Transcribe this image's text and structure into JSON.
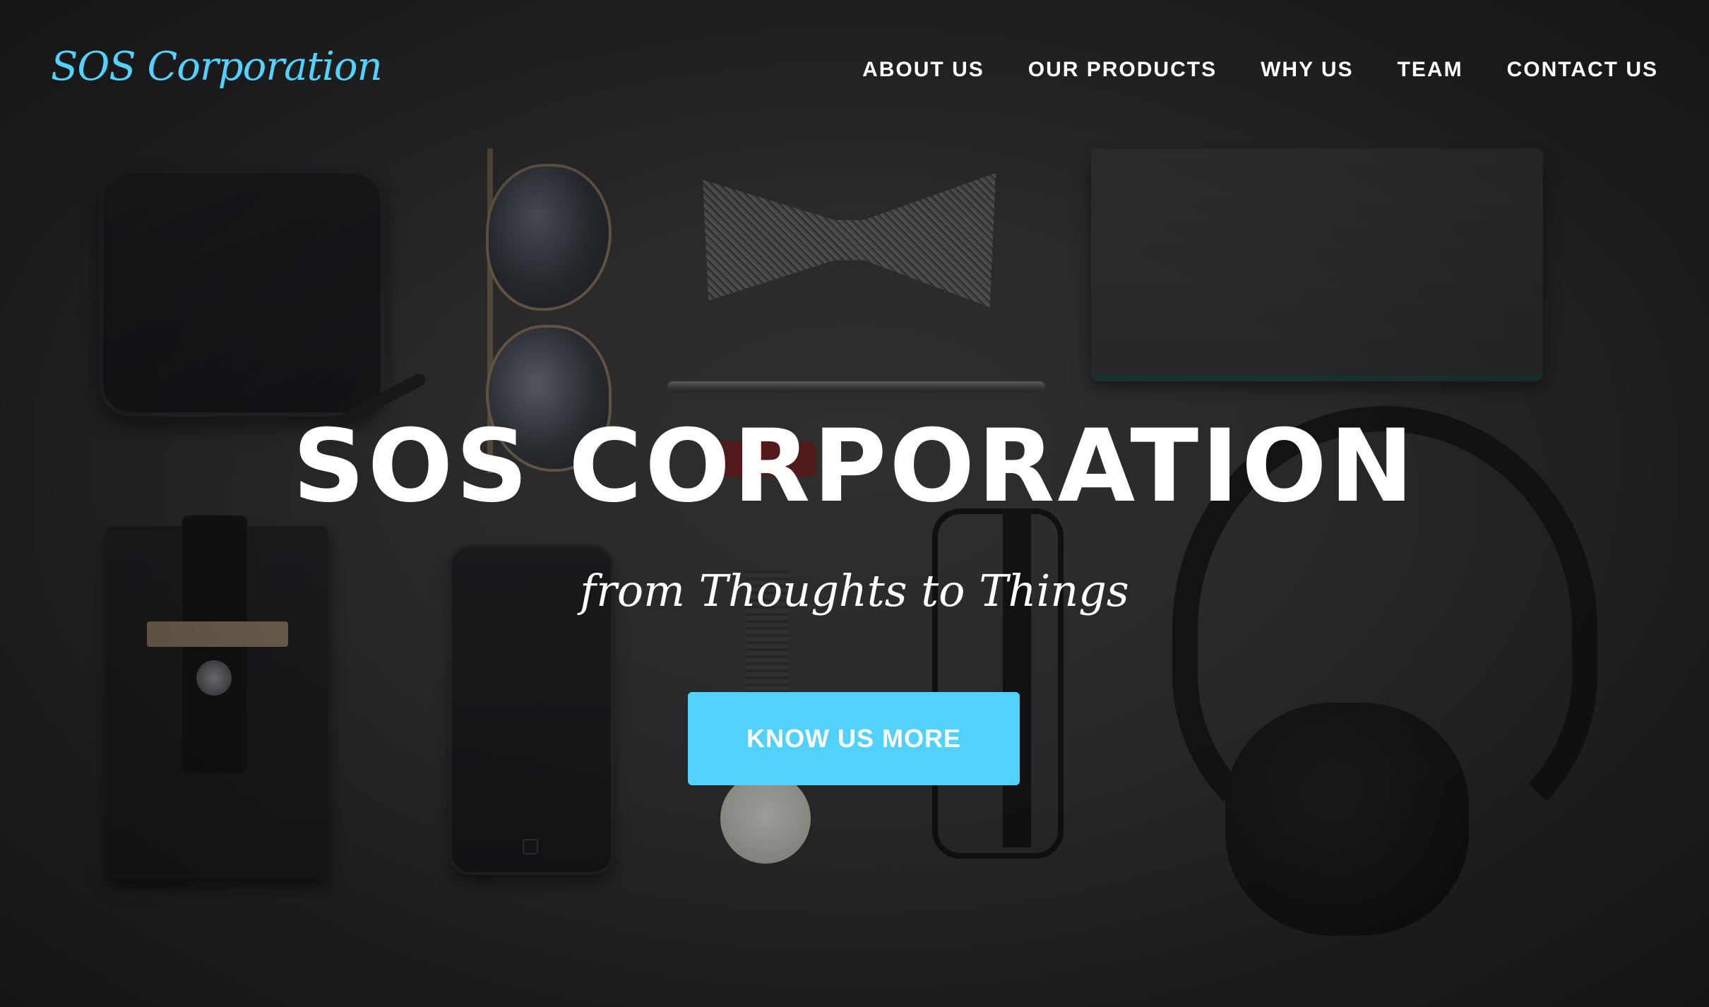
{
  "brand": {
    "name": "SOS Corporation",
    "color": "#52d2ff"
  },
  "nav": {
    "items": [
      {
        "label": "ABOUT US"
      },
      {
        "label": "OUR PRODUCTS"
      },
      {
        "label": "WHY US"
      },
      {
        "label": "TEAM"
      },
      {
        "label": "CONTACT US"
      }
    ]
  },
  "hero": {
    "title": "SOS CORPORATION",
    "subtitle": "from Thoughts to Things",
    "cta_label": "KNOW US MORE",
    "cta_color": "#51d2fd",
    "background_image": "flat-lay of dark accessories: wallet, aviator sunglasses, bow tie, pen, notebook, phone wallet, smartphone, wristwatch, reading glasses, headphones"
  }
}
